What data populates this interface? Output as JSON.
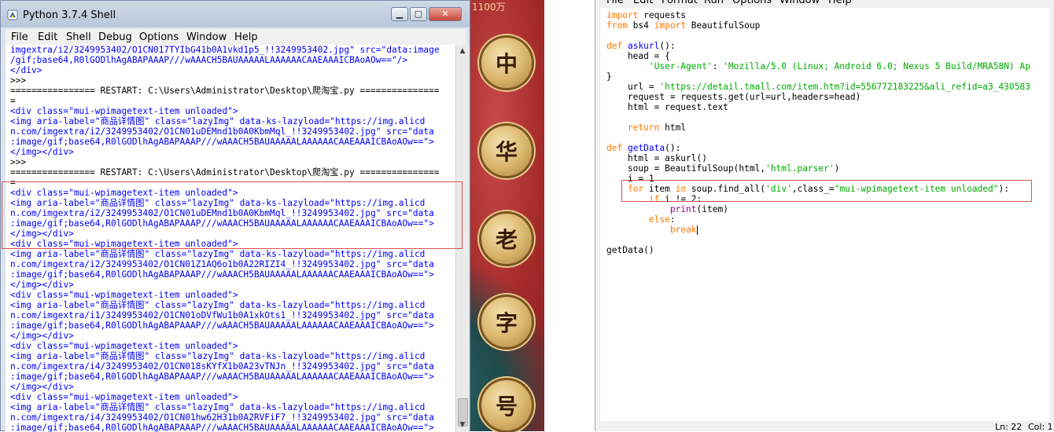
{
  "banner": {
    "top_text": "1100万",
    "coins": [
      "中",
      "华",
      "老",
      "字",
      "号"
    ]
  },
  "shell": {
    "title": "Python 3.7.4 Shell",
    "menu": [
      "File",
      "Edit",
      "Shell",
      "Debug",
      "Options",
      "Window",
      "Help"
    ],
    "lines": [
      {
        "c": "blue",
        "t": "imgextra/i2/3249953402/O1CN017TYIbG41b0A1vkd1p5_!!3249953402.jpg\" src=\"data:image"
      },
      {
        "c": "blue",
        "t": "/gif;base64,R0lGODlhAgABAPAAAP///wAAACH5BAUAAAAALAAAAAACAAEAAAICBAoAOw==\"/>"
      },
      {
        "c": "blue",
        "t": "</div>"
      },
      {
        "c": "blk",
        "t": ">>> "
      },
      {
        "c": "blk",
        "t": "================ RESTART: C:\\Users\\Administrator\\Desktop\\爬淘宝.py ==============="
      },
      {
        "c": "blk",
        "t": "="
      },
      {
        "c": "blue",
        "t": "<div class=\"mui-wpimagetext-item unloaded\">"
      },
      {
        "c": "blue",
        "t": "<img aria-label=\"商品详情图\" class=\"lazyImg\" data-ks-lazyload=\"https://img.alicd"
      },
      {
        "c": "blue",
        "t": "n.com/imgextra/i2/3249953402/O1CN01uDEMnd1b0A0KbmMql_!!3249953402.jpg\" src=\"data"
      },
      {
        "c": "blue",
        "t": ":image/gif;base64,R0lGODlhAgABAPAAAP///wAAACH5BAUAAAAALAAAAAACAAEAAAICBAoAOw==\">"
      },
      {
        "c": "blue",
        "t": "</img></div>"
      },
      {
        "c": "blk",
        "t": ">>> "
      },
      {
        "c": "blk",
        "t": "================ RESTART: C:\\Users\\Administrator\\Desktop\\爬淘宝.py ==============="
      },
      {
        "c": "blk",
        "t": "="
      },
      {
        "c": "blue",
        "t": "<div class=\"mui-wpimagetext-item unloaded\">"
      },
      {
        "c": "blue",
        "t": "<img aria-label=\"商品详情图\" class=\"lazyImg\" data-ks-lazyload=\"https://img.alicd"
      },
      {
        "c": "blue",
        "t": "n.com/imgextra/i2/3249953402/O1CN01uDEMnd1b0A0KbmMql_!!3249953402.jpg\" src=\"data"
      },
      {
        "c": "blue",
        "t": ":image/gif;base64,R0lGODlhAgABAPAAAP///wAAACH5BAUAAAAALAAAAAACAAEAAAICBAoAOw==\">"
      },
      {
        "c": "blue",
        "t": "</img></div>"
      },
      {
        "c": "blue",
        "t": "<div class=\"mui-wpimagetext-item unloaded\">"
      },
      {
        "c": "blue",
        "t": "<img aria-label=\"商品详情图\" class=\"lazyImg\" data-ks-lazyload=\"https://img.alicd"
      },
      {
        "c": "blue",
        "t": "n.com/imgextra/i2/3249953402/O1CN01Z1AQ6o1b0A22RIZI4_!!3249953402.jpg\" src=\"data"
      },
      {
        "c": "blue",
        "t": ":image/gif;base64,R0lGODlhAgABAPAAAP///wAAACH5BAUAAAAALAAAAAACAAEAAAICBAoAOw==\">"
      },
      {
        "c": "blue",
        "t": "</img></div>"
      },
      {
        "c": "blue",
        "t": "<div class=\"mui-wpimagetext-item unloaded\">"
      },
      {
        "c": "blue",
        "t": "<img aria-label=\"商品详情图\" class=\"lazyImg\" data-ks-lazyload=\"https://img.alicd"
      },
      {
        "c": "blue",
        "t": "n.com/imgextra/i1/3249953402/O1CN01oDVfWu1b0A1xkOts1_!!3249953402.jpg\" src=\"data"
      },
      {
        "c": "blue",
        "t": ":image/gif;base64,R0lGODlhAgABAPAAAP///wAAACH5BAUAAAAALAAAAAACAAEAAAICBAoAOw==\">"
      },
      {
        "c": "blue",
        "t": "</img></div>"
      },
      {
        "c": "blue",
        "t": "<div class=\"mui-wpimagetext-item unloaded\">"
      },
      {
        "c": "blue",
        "t": "<img aria-label=\"商品详情图\" class=\"lazyImg\" data-ks-lazyload=\"https://img.alicd"
      },
      {
        "c": "blue",
        "t": "n.com/imgextra/i4/3249953402/O1CN018sKYfX1b0A23vTNJn_!!3249953402.jpg\" src=\"data"
      },
      {
        "c": "blue",
        "t": ":image/gif;base64,R0lGODlhAgABAPAAAP///wAAACH5BAUAAAAALAAAAAACAAEAAAICBAoAOw==\">"
      },
      {
        "c": "blue",
        "t": "</img></div>"
      },
      {
        "c": "blue",
        "t": "<div class=\"mui-wpimagetext-item unloaded\">"
      },
      {
        "c": "blue",
        "t": "<img aria-label=\"商品详情图\" class=\"lazyImg\" data-ks-lazyload=\"https://img.alicd"
      },
      {
        "c": "blue",
        "t": "n.com/imgextra/i4/3249953402/O1CN01hw62H31b0A2RVFiF7_!!3249953402.jpg\" src=\"data"
      },
      {
        "c": "blue",
        "t": ":image/gif;base64,R0lGODlhAgABAPAAAP///wAAACH5BAUAAAAALAAAAAACAAEAAAICBAoAOw==\">"
      }
    ]
  },
  "editor": {
    "menu": [
      "File",
      "Edit",
      "Format",
      "Run",
      "Options",
      "Window",
      "Help"
    ],
    "status": {
      "line": "Ln: 22",
      "col": "Col: 1"
    },
    "lines": [
      [
        {
          "k": "kw",
          "t": "import"
        },
        {
          "k": "",
          "t": " requests"
        }
      ],
      [
        {
          "k": "kw",
          "t": "from"
        },
        {
          "k": "",
          "t": " bs4 "
        },
        {
          "k": "kw",
          "t": "import"
        },
        {
          "k": "",
          "t": " BeautifulSoup"
        }
      ],
      [
        {
          "k": "",
          "t": ""
        }
      ],
      [
        {
          "k": "kw",
          "t": "def"
        },
        {
          "k": "",
          "t": " "
        },
        {
          "k": "fn",
          "t": "askurl"
        },
        {
          "k": "",
          "t": "():"
        }
      ],
      [
        {
          "k": "",
          "t": "    head = {"
        }
      ],
      [
        {
          "k": "",
          "t": "        "
        },
        {
          "k": "str",
          "t": "'User-Agent'"
        },
        {
          "k": "",
          "t": ": "
        },
        {
          "k": "str",
          "t": "'Mozilla/5.0 (Linux; Android 6.0; Nexus 5 Build/MRA58N) Ap"
        }
      ],
      [
        {
          "k": "",
          "t": "}"
        }
      ],
      [
        {
          "k": "",
          "t": "    url = "
        },
        {
          "k": "str",
          "t": "'https://detail.tmall.com/item.htm?id=556772183225&ali_refid=a3_430583"
        }
      ],
      [
        {
          "k": "",
          "t": "    request = requests.get(url=url,headers=head)"
        }
      ],
      [
        {
          "k": "",
          "t": "    html = request.text"
        }
      ],
      [
        {
          "k": "",
          "t": ""
        }
      ],
      [
        {
          "k": "",
          "t": "    "
        },
        {
          "k": "kw",
          "t": "return"
        },
        {
          "k": "",
          "t": " html"
        }
      ],
      [
        {
          "k": "",
          "t": ""
        }
      ],
      [
        {
          "k": "kw",
          "t": "def"
        },
        {
          "k": "",
          "t": " "
        },
        {
          "k": "fn",
          "t": "getData"
        },
        {
          "k": "",
          "t": "():"
        }
      ],
      [
        {
          "k": "",
          "t": "    html = askurl()"
        }
      ],
      [
        {
          "k": "",
          "t": "    soup = BeautifulSoup(html,"
        },
        {
          "k": "str",
          "t": "'html.parser'"
        },
        {
          "k": "",
          "t": ")"
        }
      ],
      [
        {
          "k": "",
          "t": "    i = 1"
        }
      ],
      [
        {
          "k": "",
          "t": "    "
        },
        {
          "k": "kw",
          "t": "for"
        },
        {
          "k": "",
          "t": " item "
        },
        {
          "k": "kw",
          "t": "in"
        },
        {
          "k": "",
          "t": " soup.find_all("
        },
        {
          "k": "str",
          "t": "'div'"
        },
        {
          "k": "",
          "t": ",class_="
        },
        {
          "k": "str",
          "t": "\"mui-wpimagetext-item unloaded\""
        },
        {
          "k": "",
          "t": "):"
        }
      ],
      [
        {
          "k": "",
          "t": "        "
        },
        {
          "k": "kw",
          "t": "if"
        },
        {
          "k": "",
          "t": " i != 2:"
        }
      ],
      [
        {
          "k": "",
          "t": "            "
        },
        {
          "k": "bi",
          "t": "print"
        },
        {
          "k": "",
          "t": "(item)"
        }
      ],
      [
        {
          "k": "",
          "t": "        "
        },
        {
          "k": "kw",
          "t": "else"
        },
        {
          "k": "",
          "t": ":"
        }
      ],
      [
        {
          "k": "",
          "t": "            "
        },
        {
          "k": "kw",
          "t": "break"
        }
      ],
      [
        {
          "k": "",
          "t": ""
        }
      ],
      [
        {
          "k": "",
          "t": "getData()"
        }
      ]
    ]
  }
}
